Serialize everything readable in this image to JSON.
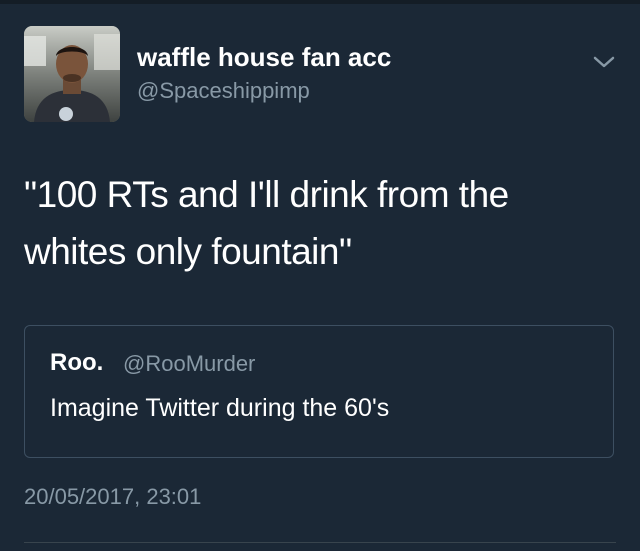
{
  "tweet": {
    "author": {
      "display_name": "waffle house fan acc",
      "handle": "@Spaceshippimp",
      "avatar_icon": "user-avatar-photo"
    },
    "menu_icon": "chevron-down-icon",
    "text_line1": "\"100 RTs and I'll drink from the",
    "text_line2": "whites only fountain\"",
    "quoted_tweet": {
      "display_name": "Roo.",
      "handle": "@RooMurder",
      "text": "Imagine Twitter during the 60's"
    },
    "timestamp": "20/05/2017, 23:01"
  },
  "colors": {
    "background": "#1b2836",
    "primary_text": "#ffffff",
    "secondary_text": "#8899a6",
    "card_border": "#3d4f61"
  }
}
